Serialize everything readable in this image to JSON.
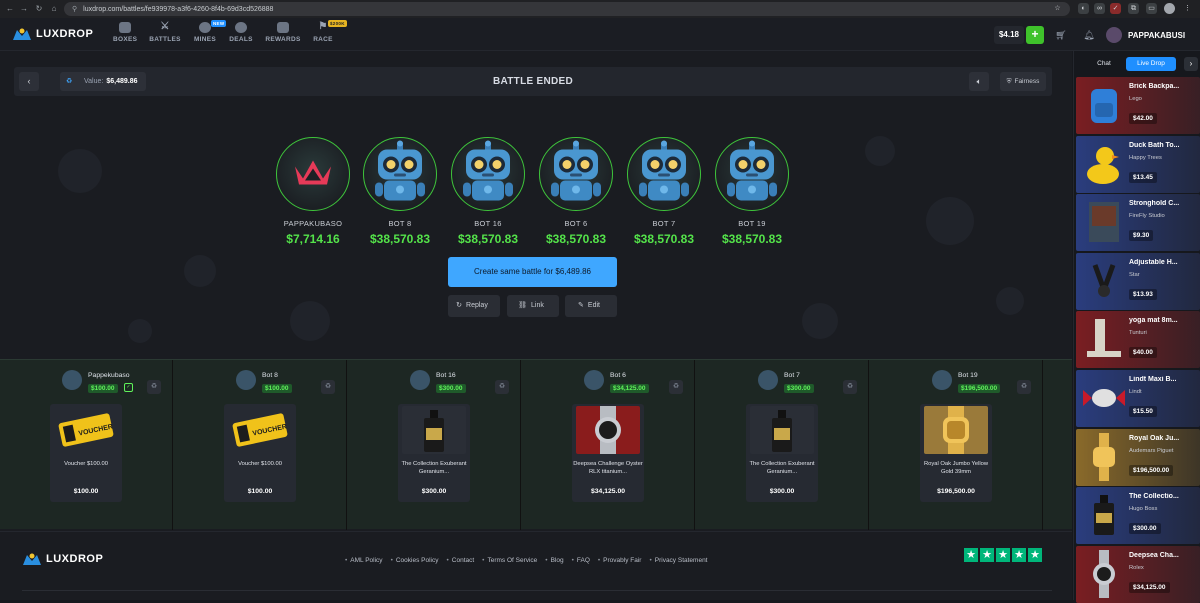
{
  "browser": {
    "url": "luxdrop.com/battles/fe939978-a3f6-4260-8f4b-69d3cd526888"
  },
  "header": {
    "logo": "LUXDROP",
    "nav": [
      {
        "label": "BOXES",
        "icon": "box-icon"
      },
      {
        "label": "BATTLES",
        "icon": "swords-icon"
      },
      {
        "label": "MINES",
        "icon": "mine-icon",
        "badge": "NEW"
      },
      {
        "label": "DEALS",
        "icon": "deal-icon"
      },
      {
        "label": "REWARDS",
        "icon": "gift-icon"
      },
      {
        "label": "RACE",
        "icon": "race-flag-icon",
        "badge": "$200K"
      }
    ],
    "balance": "$4.18",
    "deposit_label": "+",
    "username": "PAPPAKABUSI"
  },
  "battle": {
    "value_label": "Value:",
    "value": "$6,489.86",
    "title": "BATTLE ENDED",
    "fairness_label": "Fairness",
    "players": [
      {
        "name": "PAPPAKUBASO",
        "amount": "$7,714.16",
        "avatar": "crown-logo"
      },
      {
        "name": "BOT 8",
        "amount": "$38,570.83",
        "avatar": "robot"
      },
      {
        "name": "BOT 16",
        "amount": "$38,570.83",
        "avatar": "robot"
      },
      {
        "name": "BOT 6",
        "amount": "$38,570.83",
        "avatar": "robot"
      },
      {
        "name": "BOT 7",
        "amount": "$38,570.83",
        "avatar": "robot"
      },
      {
        "name": "BOT 19",
        "amount": "$38,570.83",
        "avatar": "robot"
      }
    ],
    "create_button": "Create same battle for $6,489.86",
    "replay_label": "Replay",
    "link_label": "Link",
    "edit_label": "Edit"
  },
  "item_columns": [
    {
      "player": "Pappekubaso",
      "total": "$100.00",
      "item_name": "Voucher $100.00",
      "item_price": "$100.00",
      "item_type": "voucher",
      "winner": true
    },
    {
      "player": "Bot 8",
      "total": "$100.00",
      "item_name": "Voucher $100.00",
      "item_price": "$100.00",
      "item_type": "voucher",
      "winner": false
    },
    {
      "player": "Bot 16",
      "total": "$300.00",
      "item_name": "The Collection Exuberant Geranium...",
      "item_price": "$300.00",
      "item_type": "perfume",
      "winner": false
    },
    {
      "player": "Bot 6",
      "total": "$34,125.00",
      "item_name": "Deepsea Challenge Oyster RLX titanium...",
      "item_price": "$34,125.00",
      "item_type": "watch-silver",
      "winner": false
    },
    {
      "player": "Bot 7",
      "total": "$300.00",
      "item_name": "The Collection Exuberant Geranium...",
      "item_price": "$300.00",
      "item_type": "perfume",
      "winner": false
    },
    {
      "player": "Bot 19",
      "total": "$196,500.00",
      "item_name": "Royal Oak Jumbo Yellow Gold 39mm",
      "item_price": "$196,500.00",
      "item_type": "watch-gold",
      "winner": false
    }
  ],
  "voucher_text": "VOUCHER",
  "footer": {
    "logo": "LUXDROP",
    "links": [
      "AML Policy",
      "Cookies Policy",
      "Contact",
      "Terms Of Service",
      "Blog",
      "FAQ",
      "Provably Fair",
      "Privacy Statement"
    ],
    "rating_stars": 5
  },
  "panel": {
    "tab_chat": "Chat",
    "tab_live": "Live Drop",
    "drops": [
      {
        "name": "Brick Backpa...",
        "brand": "Lego",
        "price": "$42.00",
        "color": "#7a1e22",
        "type": "backpack"
      },
      {
        "name": "Duck Bath To...",
        "brand": "Happy Trees",
        "price": "$13.45",
        "color": "#2a3d7e",
        "type": "duck"
      },
      {
        "name": "Stronghold C...",
        "brand": "FireFly Studio",
        "price": "$9.30",
        "color": "#2a3d7e",
        "type": "game"
      },
      {
        "name": "Adjustable H...",
        "brand": "Star",
        "price": "$13.93",
        "color": "#2a3d7e",
        "type": "gripper"
      },
      {
        "name": "yoga mat 8m...",
        "brand": "Tunturi",
        "price": "$40.00",
        "color": "#7a1e22",
        "type": "yogamat"
      },
      {
        "name": "Lindt Maxi B...",
        "brand": "Lindt",
        "price": "$15.50",
        "color": "#2a3d7e",
        "type": "candy"
      },
      {
        "name": "Royal Oak Ju...",
        "brand": "Audemars Piguet",
        "price": "$196,500.00",
        "color": "#8a6a2a",
        "type": "watch-gold"
      },
      {
        "name": "The Collectio...",
        "brand": "Hugo Boss",
        "price": "$300.00",
        "color": "#2a3d7e",
        "type": "perfume"
      },
      {
        "name": "Deepsea Cha...",
        "brand": "Rolex",
        "price": "$34,125.00",
        "color": "#7a1e22",
        "type": "watch-silver"
      }
    ]
  }
}
